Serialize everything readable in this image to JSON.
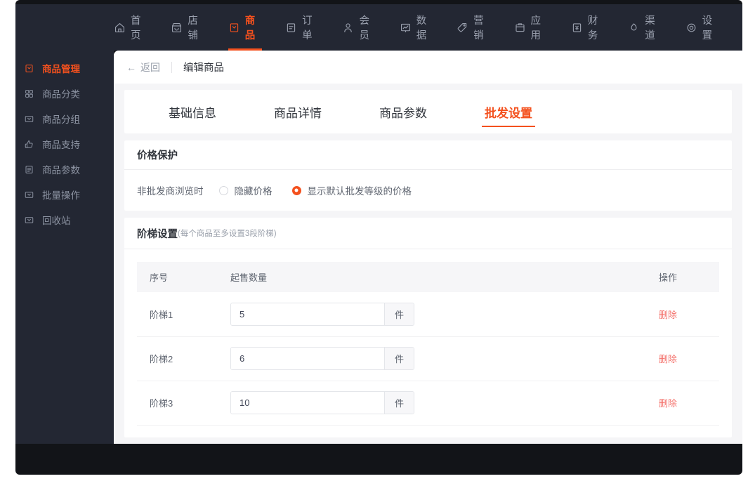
{
  "topnav": {
    "items": [
      {
        "label": "首页",
        "icon": "home-icon",
        "active": false
      },
      {
        "label": "店铺",
        "icon": "shop-icon",
        "active": false
      },
      {
        "label": "商品",
        "icon": "product-icon",
        "active": true
      },
      {
        "label": "订单",
        "icon": "order-icon",
        "active": false
      },
      {
        "label": "会员",
        "icon": "member-icon",
        "active": false
      },
      {
        "label": "数据",
        "icon": "chart-icon",
        "active": false
      },
      {
        "label": "营销",
        "icon": "tag-icon",
        "active": false
      },
      {
        "label": "应用",
        "icon": "app-box-icon",
        "active": false
      },
      {
        "label": "财务",
        "icon": "finance-icon",
        "active": false
      },
      {
        "label": "渠道",
        "icon": "channel-icon",
        "active": false
      },
      {
        "label": "设置",
        "icon": "gear-icon",
        "active": false
      }
    ]
  },
  "sidebar": {
    "items": [
      {
        "label": "商品管理",
        "icon": "product-icon",
        "active": true
      },
      {
        "label": "商品分类",
        "icon": "grid-icon",
        "active": false
      },
      {
        "label": "商品分组",
        "icon": "folder-icon",
        "active": false
      },
      {
        "label": "商品支持",
        "icon": "thumbs-up-icon",
        "active": false
      },
      {
        "label": "商品参数",
        "icon": "list-icon",
        "active": false
      },
      {
        "label": "批量操作",
        "icon": "folder-icon",
        "active": false
      },
      {
        "label": "回收站",
        "icon": "folder-icon",
        "active": false
      }
    ]
  },
  "breadcrumb": {
    "back_label": "返回",
    "back_arrow": "←",
    "title": "编辑商品"
  },
  "tabs": [
    {
      "label": "基础信息",
      "active": false
    },
    {
      "label": "商品详情",
      "active": false
    },
    {
      "label": "商品参数",
      "active": false
    },
    {
      "label": "批发设置",
      "active": true
    }
  ],
  "price_protection": {
    "title": "价格保护",
    "row_label": "非批发商浏览时",
    "options": [
      {
        "label": "隐藏价格",
        "selected": false
      },
      {
        "label": "显示默认批发等级的价格",
        "selected": true
      }
    ]
  },
  "ladder": {
    "title": "阶梯设置",
    "subtitle": "(每个商品至多设置3段阶梯)",
    "columns": [
      "序号",
      "起售数量",
      "操作"
    ],
    "unit_suffix": "件",
    "delete_label": "删除",
    "rows": [
      {
        "index": "阶梯1",
        "qty": "5"
      },
      {
        "index": "阶梯2",
        "qty": "6"
      },
      {
        "index": "阶梯3",
        "qty": "10"
      }
    ]
  },
  "colors": {
    "accent": "#f4511e",
    "nav_bg": "#232733",
    "frame_bg": "#121418",
    "content_bg": "#f5f5f7",
    "delete_red": "#f4706a"
  }
}
